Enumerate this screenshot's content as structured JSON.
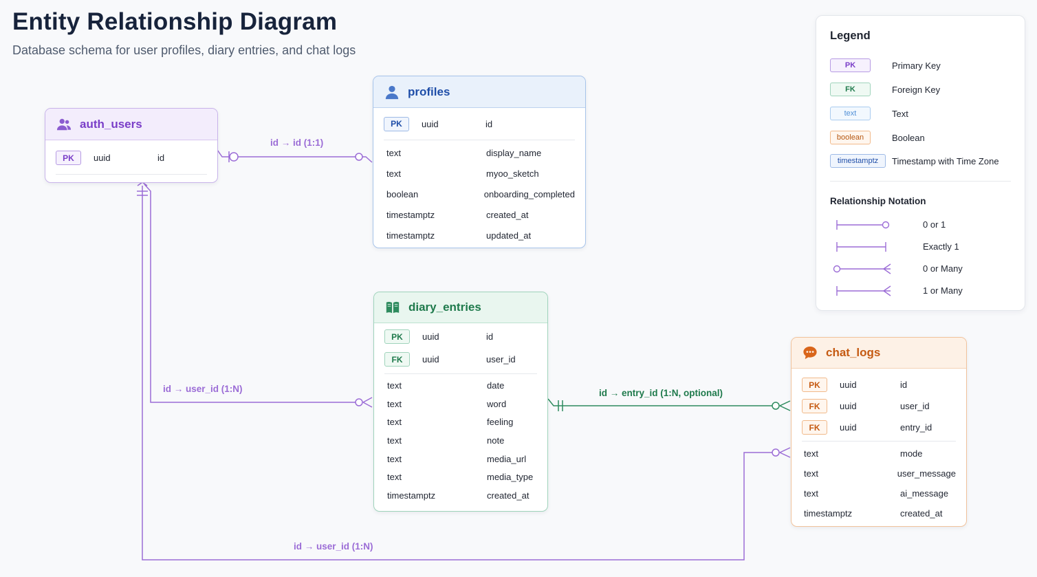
{
  "title": "Entity Relationship Diagram",
  "subtitle": "Database schema for user profiles, diary entries, and chat logs",
  "colors": {
    "auth": "#7a3ec8",
    "profiles": "#1f4ea8",
    "diary": "#1f7a4c",
    "chat": "#c55a12",
    "relation_purple": "#9b6cd6",
    "relation_green": "#2e8b5e"
  },
  "entities": {
    "auth_users": {
      "name": "auth_users",
      "icon": "users-icon",
      "key_rows": [
        {
          "badge": "PK",
          "type": "uuid",
          "column": "id"
        }
      ],
      "rows": []
    },
    "profiles": {
      "name": "profiles",
      "icon": "user-icon",
      "key_rows": [
        {
          "badge": "PK",
          "type": "uuid",
          "column": "id"
        }
      ],
      "rows": [
        {
          "type": "text",
          "column": "display_name"
        },
        {
          "type": "text",
          "column": "myoo_sketch"
        },
        {
          "type": "boolean",
          "column": "onboarding_completed"
        },
        {
          "type": "timestamptz",
          "column": "created_at"
        },
        {
          "type": "timestamptz",
          "column": "updated_at"
        }
      ]
    },
    "diary_entries": {
      "name": "diary_entries",
      "icon": "book-icon",
      "key_rows": [
        {
          "badge": "PK",
          "type": "uuid",
          "column": "id"
        },
        {
          "badge": "FK",
          "type": "uuid",
          "column": "user_id"
        }
      ],
      "rows": [
        {
          "type": "text",
          "column": "date"
        },
        {
          "type": "text",
          "column": "word"
        },
        {
          "type": "text",
          "column": "feeling"
        },
        {
          "type": "text",
          "column": "note"
        },
        {
          "type": "text",
          "column": "media_url"
        },
        {
          "type": "text",
          "column": "media_type"
        },
        {
          "type": "timestamptz",
          "column": "created_at"
        }
      ]
    },
    "chat_logs": {
      "name": "chat_logs",
      "icon": "chat-bubble-icon",
      "key_rows": [
        {
          "badge": "PK",
          "type": "uuid",
          "column": "id"
        },
        {
          "badge": "FK",
          "type": "uuid",
          "column": "user_id"
        },
        {
          "badge": "FK",
          "type": "uuid",
          "column": "entry_id"
        }
      ],
      "rows": [
        {
          "type": "text",
          "column": "mode"
        },
        {
          "type": "text",
          "column": "user_message"
        },
        {
          "type": "text",
          "column": "ai_message"
        },
        {
          "type": "timestamptz",
          "column": "created_at"
        }
      ]
    }
  },
  "relationships": {
    "auth_profiles": "id → id (1:1)",
    "auth_diary": "id → user_id (1:N)",
    "diary_chat": "id → entry_id (1:N, optional)",
    "auth_chat": "id → user_id (1:N)"
  },
  "legend": {
    "title": "Legend",
    "items": [
      {
        "badge": "PK",
        "label": "Primary Key",
        "color": "#7a3ec8"
      },
      {
        "badge": "FK",
        "label": "Foreign Key",
        "color": "#1f7a4c"
      },
      {
        "badge": "text",
        "label": "Text",
        "color": "#4f8fd6"
      },
      {
        "badge": "boolean",
        "label": "Boolean",
        "color": "#c55a12"
      },
      {
        "badge": "timestamptz",
        "label": "Timestamp with Time Zone",
        "color": "#1f4ea8"
      }
    ],
    "relationship_title": "Relationship Notation",
    "notations": [
      {
        "label": "0 or 1",
        "symbol": "zero-or-one-icon"
      },
      {
        "label": "Exactly 1",
        "symbol": "exactly-one-icon"
      },
      {
        "label": "0 or Many",
        "symbol": "zero-or-many-icon"
      },
      {
        "label": "1 or Many",
        "symbol": "one-or-many-icon"
      }
    ]
  }
}
